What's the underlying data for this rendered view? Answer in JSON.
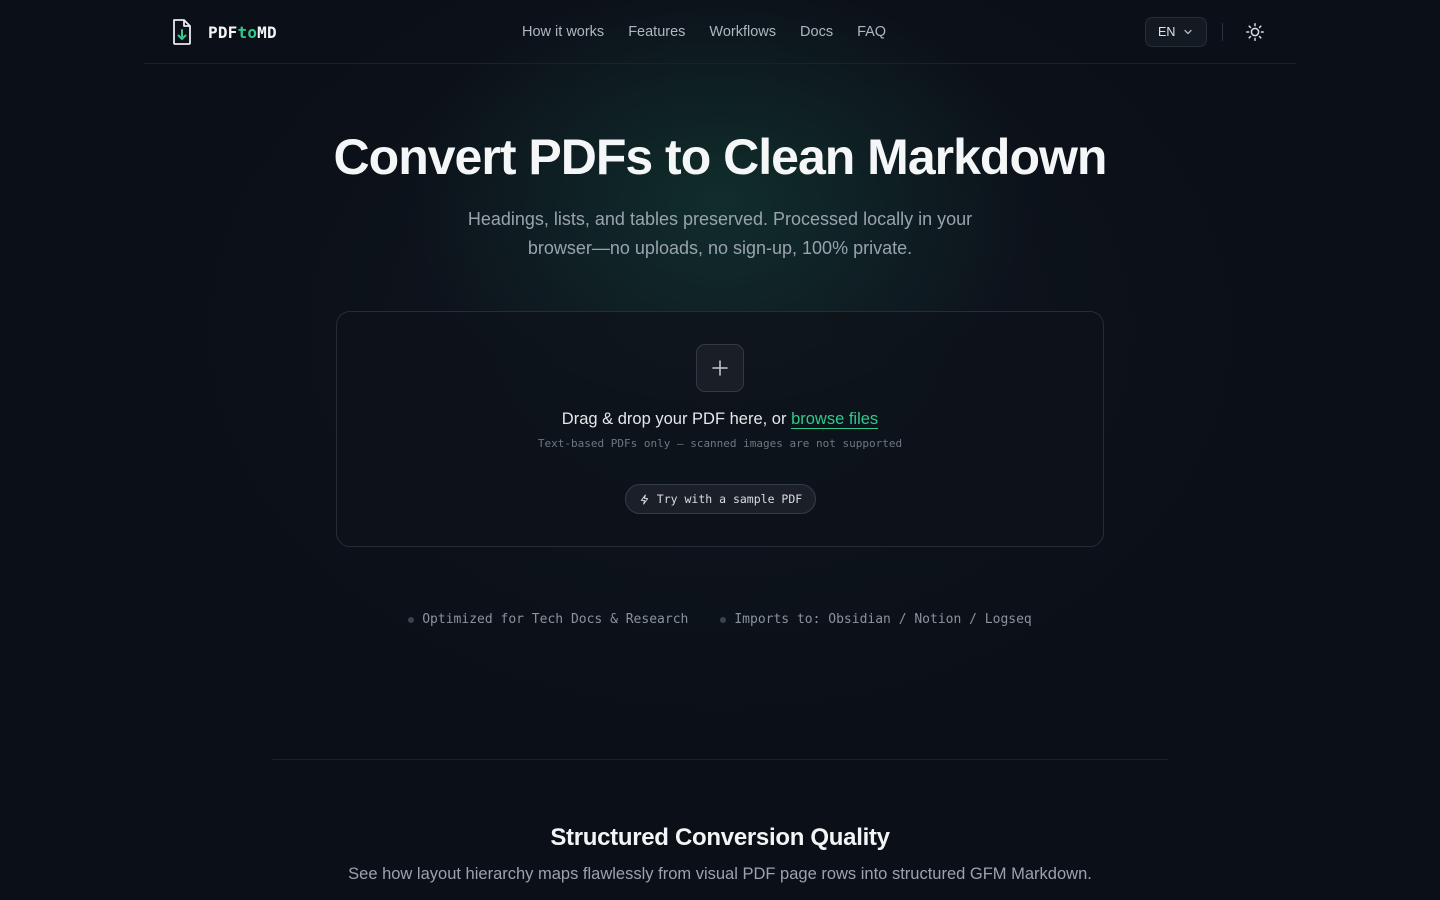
{
  "header": {
    "logo": {
      "part1": "PDF",
      "part2": "to",
      "part3": "MD",
      "icon": "file-download-icon"
    },
    "nav": [
      "How it works",
      "Features",
      "Workflows",
      "Docs",
      "FAQ"
    ],
    "language": "EN",
    "theme_icon": "sun-icon"
  },
  "hero": {
    "title": "Convert PDFs to Clean Markdown",
    "subtitle_line1": "Headings, lists, and tables preserved. Processed locally in your",
    "subtitle_line2": "browser—no uploads, no sign-up, 100% private."
  },
  "dropzone": {
    "main_text": "Drag & drop your PDF here, or ",
    "browse_link": "browse files",
    "hint": "Text-based PDFs only — scanned images are not supported",
    "sample_button": "Try with a sample PDF",
    "add_icon": "plus-icon"
  },
  "tags": [
    "Optimized for Tech Docs & Research",
    "Imports to: Obsidian / Notion / Logseq"
  ],
  "section": {
    "title": "Structured Conversion Quality",
    "subtitle": "See how layout hierarchy maps flawlessly from visual PDF page rows into structured GFM Markdown."
  },
  "colors": {
    "accent": "#2fc98a",
    "background": "#0b0f17"
  }
}
